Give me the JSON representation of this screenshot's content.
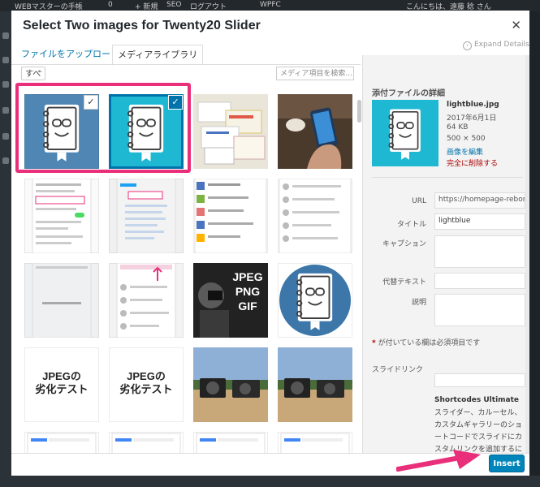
{
  "admin_bar": {
    "site": "WEBマスターの手帳",
    "comments": "0",
    "new": "+ 新規",
    "seo": "SEO",
    "login_log": "ログアウト",
    "wpfc": "WPFC",
    "greeting": "こんにちは、遠藤 稔 さん"
  },
  "modal": {
    "title": "Select Two images for Twenty20 Slider",
    "close_icon": "close-icon",
    "tabs": {
      "upload": "ファイルをアップロード",
      "library": "メディアライブラリ"
    },
    "expand_details": "Expand Details"
  },
  "browser": {
    "filter_value": "すべ",
    "search_placeholder": "メディア項目を検索..."
  },
  "grid": {
    "jpeg_quality_text_1": "JPEGの",
    "jpeg_quality_text_2": "劣化テスト",
    "format_text_1": "JPEG",
    "format_text_2": "PNG",
    "format_text_3": "GIF"
  },
  "details": {
    "heading": "添付ファイルの詳細",
    "filename": "lightblue.jpg",
    "date": "2017年6月1日",
    "size": "64 KB",
    "dimensions": "500 × 500",
    "edit_link": "画像を編集",
    "delete_link": "完全に削除する",
    "fields": {
      "url_label": "URL",
      "url_value": "https://homepage-reborn.",
      "title_label": "タイトル",
      "title_value": "lightblue",
      "caption_label": "キャプション",
      "alt_label": "代替テキスト",
      "description_label": "説明"
    },
    "required_note_mark": "*",
    "required_note": " が付いている欄は必須項目です",
    "slide_link_label": "スライドリンク",
    "shortcodes_title": "Shortcodes Ultimate",
    "shortcodes_text": "スライダー、カルーセル、カスタムギャラリーのショートコードでスライドにカスタムリンクを追加するには、このフィールドを使用"
  },
  "toolbar": {
    "insert_label": "Insert"
  },
  "colors": {
    "accent": "#0085ba",
    "highlight": "#ea2f7a",
    "thumb_dark": "#4f86b3",
    "thumb_cyan": "#1fb8d3"
  }
}
